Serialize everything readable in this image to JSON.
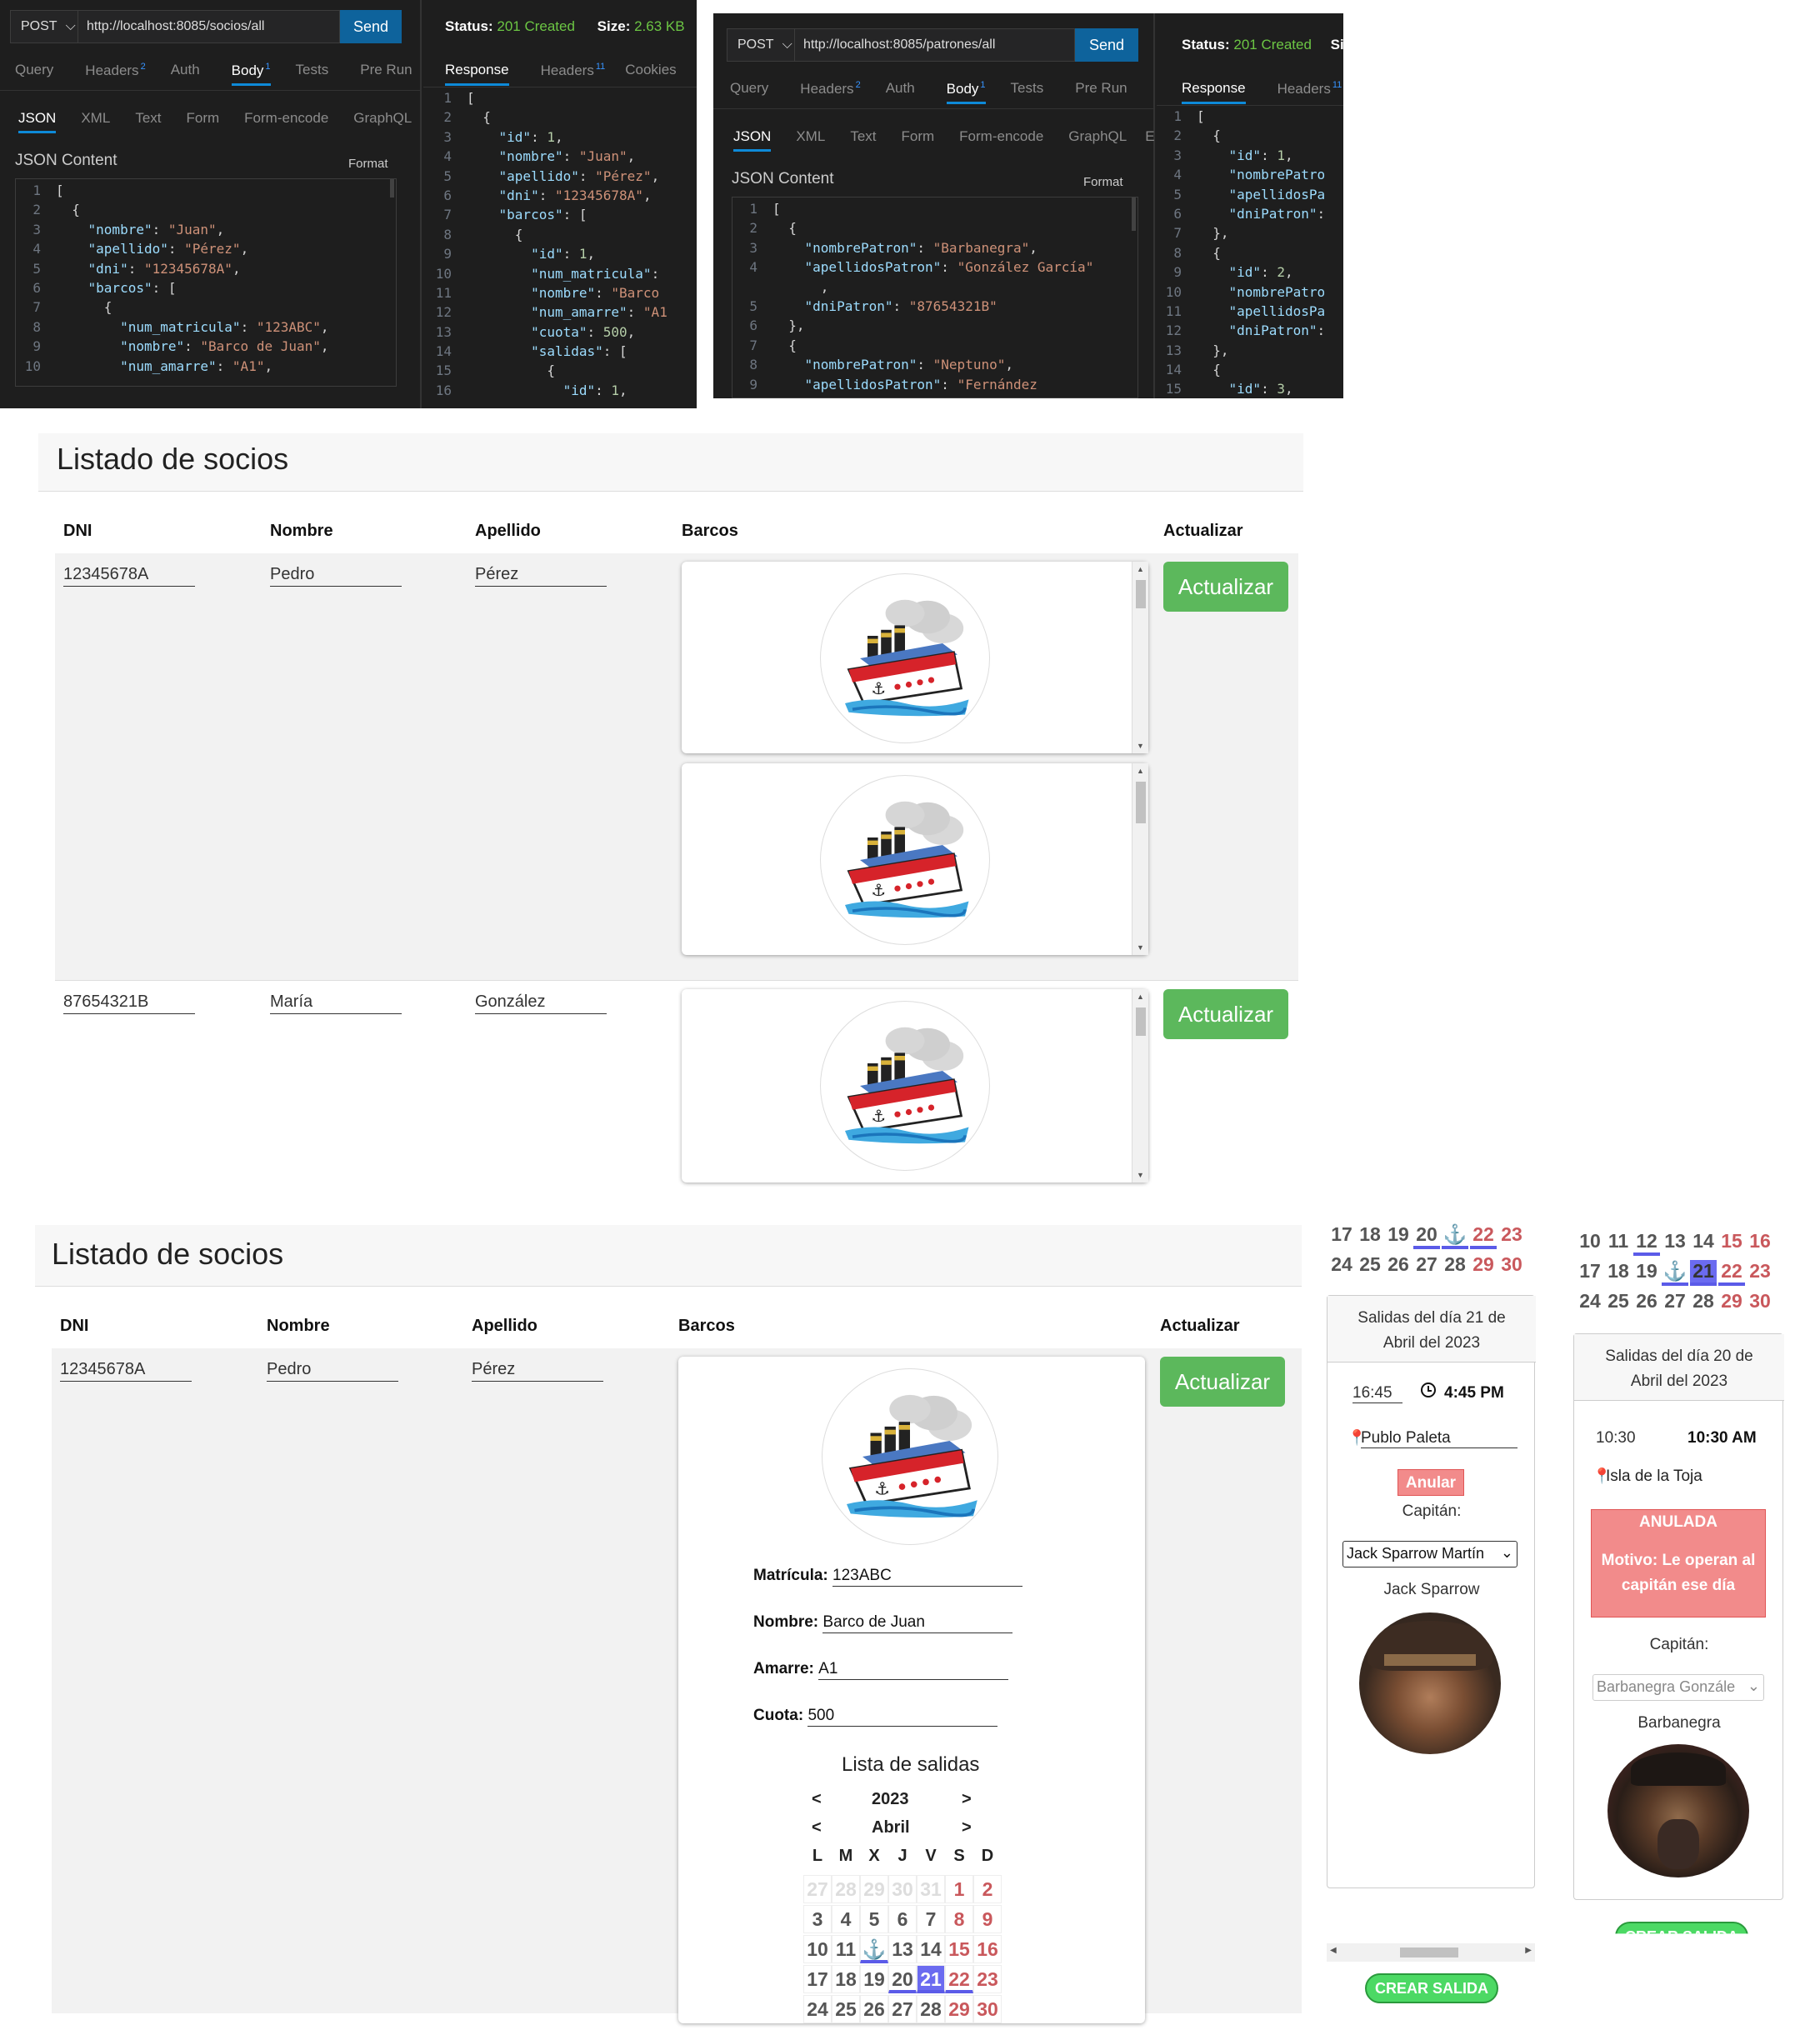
{
  "tc1": {
    "method": "POST",
    "url": "http://localhost:8085/socios/all",
    "send": "Send",
    "tabs": [
      "Query",
      "Headers",
      "Auth",
      "Body",
      "Tests",
      "Pre Run"
    ],
    "headers_count": "2",
    "body_count": "1",
    "body_tabs": [
      "JSON",
      "XML",
      "Text",
      "Form",
      "Form-encode",
      "GraphQL"
    ],
    "json_content_label": "JSON Content",
    "format_label": "Format",
    "status_label": "Status:",
    "status_value": "201 Created",
    "size_label": "Size:",
    "size_value": "2.63 KB",
    "resp_tabs": [
      "Response",
      "Headers",
      "Cookies"
    ],
    "resp_headers_count": "11"
  },
  "tc2": {
    "method": "POST",
    "url": "http://localhost:8085/patrones/all",
    "send": "Send",
    "tabs": [
      "Query",
      "Headers",
      "Auth",
      "Body",
      "Tests",
      "Pre Run"
    ],
    "headers_count": "2",
    "body_count": "1",
    "body_tabs": [
      "JSON",
      "XML",
      "Text",
      "Form",
      "Form-encode",
      "GraphQL",
      "E"
    ],
    "json_content_label": "JSON Content",
    "format_label": "Format",
    "status_label": "Status:",
    "status_value": "201 Created",
    "size_label": "Si",
    "resp_tabs": [
      "Response",
      "Headers"
    ],
    "resp_headers_count": "11"
  },
  "page1": {
    "title": "Listado de socios",
    "columns": [
      "DNI",
      "Nombre",
      "Apellido",
      "Barcos",
      "Actualizar"
    ],
    "rows": [
      {
        "dni": "12345678A",
        "nombre": "Pedro",
        "apellido": "Pérez",
        "button": "Actualizar"
      },
      {
        "dni": "87654321B",
        "nombre": "María",
        "apellido": "González",
        "button": "Actualizar"
      }
    ]
  },
  "page2": {
    "title": "Listado de socios",
    "columns": [
      "DNI",
      "Nombre",
      "Apellido",
      "Barcos",
      "Actualizar"
    ],
    "row": {
      "dni": "12345678A",
      "nombre": "Pedro",
      "apellido": "Pérez",
      "button": "Actualizar"
    },
    "barco": {
      "matricula_label": "Matrícula:",
      "matricula": "123ABC",
      "nombre_label": "Nombre:",
      "nombre": "Barco de Juan",
      "amarre_label": "Amarre:",
      "amarre": "A1",
      "cuota_label": "Cuota:",
      "cuota": "500"
    },
    "salidas_title": "Lista de salidas",
    "year": "2023",
    "month": "Abril",
    "prev": "<",
    "next": ">",
    "weekdays": [
      "L",
      "M",
      "X",
      "J",
      "V",
      "S",
      "D"
    ]
  },
  "salida1": {
    "header": "Salidas del día 21 de Abril del 2023",
    "time_input": "16:45",
    "time_display": "4:45 PM",
    "destino": "Publo Paleta",
    "anular": "Anular",
    "capitan_label": "Capitán:",
    "capitan_select": "Jack Sparrow Martín",
    "capitan_name": "Jack Sparrow",
    "crear": "CREAR SALIDA"
  },
  "salida2": {
    "header": "Salidas del día 20 de Abril del 2023",
    "time_input": "10:30",
    "time_display": "10:30 AM",
    "destino": "Isla de la Toja",
    "anulada": "ANULADA",
    "motivo": "Motivo: Le operan al capitán ese día",
    "capitan_label": "Capitán:",
    "capitan_select": "Barbanegra Gonzále",
    "capitan_name": "Barbanegra",
    "crear": "CREAR SALIDA"
  },
  "colors": {
    "accent_blue": "#0e639c",
    "green": "#5cb85c",
    "red_day": "#c9585c",
    "anulada": "#f28b8b",
    "status_green": "#6cc644"
  }
}
